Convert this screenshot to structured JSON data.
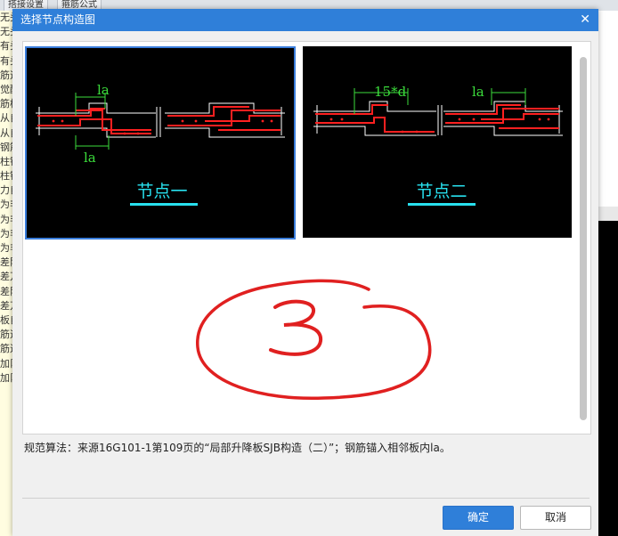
{
  "background": {
    "tabs": [
      "搭接设置",
      "箍筋公式"
    ],
    "left_list": [
      "无头",
      "无头",
      "有头",
      "有头",
      "筋遇",
      "觉醒",
      "筋梯",
      "从自",
      "从自",
      "钢筋",
      "柱钢",
      "柱钢",
      "力自",
      "为非",
      "为非",
      "为非",
      "为非",
      "差阵",
      "差万",
      "差阵",
      "差万",
      "板自",
      "筋遇",
      "筋遇",
      "加阝",
      "加阝"
    ]
  },
  "dialog": {
    "title": "选择节点构造图",
    "close_icon": "close-icon",
    "nodes": [
      {
        "label": "节点一",
        "dim_top": "la",
        "dim_bottom": "la",
        "selected": true
      },
      {
        "label": "节点二",
        "dim_left": "15*d",
        "dim_right": "la",
        "selected": false
      }
    ],
    "annotation": "3",
    "rule_text": "规范算法：来源16G101-1第109页的“局部升降板SJB构造（二）”；钢筋锚入相邻板内la。",
    "ok_label": "确定",
    "cancel_label": "取消"
  },
  "colors": {
    "accent": "#2f7fd9",
    "node_label": "#28e0ee",
    "rebar": "#ff2020",
    "dim": "#3bdc3b",
    "annotation": "#e02020"
  }
}
